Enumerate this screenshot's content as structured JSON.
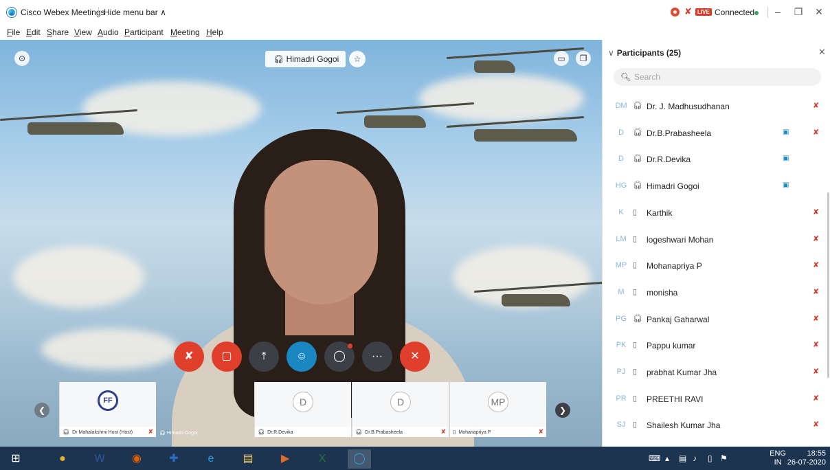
{
  "window": {
    "app_title": "Cisco Webex Meetings",
    "hide_menu_label": "Hide menu bar",
    "hide_menu_chevron": "∧",
    "live_badge": "LIVE",
    "connection_status": "Connected",
    "minimize": "–",
    "restore": "❐",
    "close": "✕"
  },
  "menu": [
    "File",
    "Edit",
    "Share",
    "View",
    "Audio",
    "Participant",
    "Meeting",
    "Help"
  ],
  "video": {
    "active_speaker": "Himadri Gogoi",
    "controls": {
      "mute": "✘",
      "stop_video": "▢",
      "share": "⤒",
      "participants": "☺",
      "chat": "◯",
      "more": "···",
      "leave": "✕"
    }
  },
  "thumbnails": [
    {
      "initials": "",
      "name": "Dr Mahalakshmi Host (Host)",
      "muted": true
    },
    {
      "initials": "D",
      "name": "Dr.R.Devika",
      "muted": false
    },
    {
      "initials": "D",
      "name": "Dr.B.Prabasheela",
      "muted": true
    },
    {
      "initials": "MP",
      "name": "Mohanapriya P",
      "muted": true
    }
  ],
  "thumb_loose_name": "Himadri Gogoi",
  "thumb_logo_text": "FF",
  "participants_panel": {
    "title": "Participants (25)",
    "search_placeholder": "Search",
    "participants": [
      {
        "initials": "DM",
        "name": "Dr. J. Madhusudhanan",
        "device": "headset",
        "video": false,
        "muted": true
      },
      {
        "initials": "D",
        "name": "Dr.B.Prabasheela",
        "device": "headset",
        "video": true,
        "muted": true
      },
      {
        "initials": "D",
        "name": "Dr.R.Devika",
        "device": "headset",
        "video": true,
        "muted": false
      },
      {
        "initials": "HG",
        "name": "Himadri Gogoi",
        "device": "headset",
        "video": true,
        "muted": false
      },
      {
        "initials": "K",
        "name": "Karthik",
        "device": "phone",
        "video": false,
        "muted": true
      },
      {
        "initials": "LM",
        "name": "logeshwari Mohan",
        "device": "phone",
        "video": false,
        "muted": true
      },
      {
        "initials": "MP",
        "name": "Mohanapriya P",
        "device": "phone",
        "video": false,
        "muted": true
      },
      {
        "initials": "M",
        "name": "monisha",
        "device": "phone",
        "video": false,
        "muted": true
      },
      {
        "initials": "PG",
        "name": "Pankaj Gaharwal",
        "device": "headset",
        "video": false,
        "muted": true
      },
      {
        "initials": "PK",
        "name": "Pappu kumar",
        "device": "phone",
        "video": false,
        "muted": true
      },
      {
        "initials": "PJ",
        "name": "prabhat Kumar Jha",
        "device": "phone",
        "video": false,
        "muted": true
      },
      {
        "initials": "PR",
        "name": "PREETHI RAVI",
        "device": "phone",
        "video": false,
        "muted": true
      },
      {
        "initials": "SJ",
        "name": "Shailesh Kumar Jha",
        "device": "phone",
        "video": false,
        "muted": true
      }
    ]
  },
  "taskbar": {
    "language_line1": "ENG",
    "language_line2": "IN",
    "time": "18:55",
    "date": "26-07-2020",
    "apps": [
      "chrome-icon",
      "word-icon",
      "firefox-icon",
      "defender-icon",
      "ie-icon",
      "explorer-icon",
      "media-icon",
      "excel-icon",
      "webex-icon"
    ]
  }
}
